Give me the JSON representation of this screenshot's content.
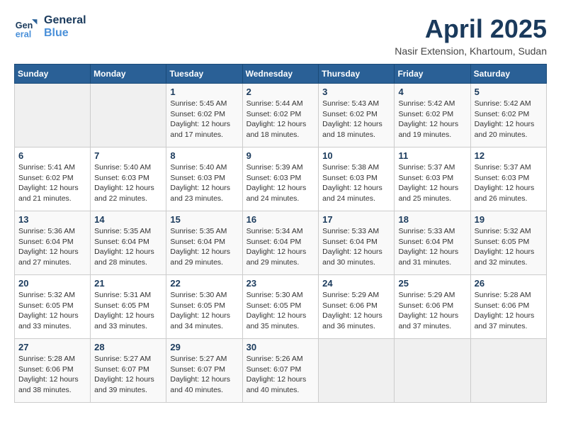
{
  "logo": {
    "line1": "General",
    "line2": "Blue"
  },
  "title": "April 2025",
  "subtitle": "Nasir Extension, Khartoum, Sudan",
  "weekdays": [
    "Sunday",
    "Monday",
    "Tuesday",
    "Wednesday",
    "Thursday",
    "Friday",
    "Saturday"
  ],
  "weeks": [
    [
      {
        "day": "",
        "info": ""
      },
      {
        "day": "",
        "info": ""
      },
      {
        "day": "1",
        "info": "Sunrise: 5:45 AM\nSunset: 6:02 PM\nDaylight: 12 hours and 17 minutes."
      },
      {
        "day": "2",
        "info": "Sunrise: 5:44 AM\nSunset: 6:02 PM\nDaylight: 12 hours and 18 minutes."
      },
      {
        "day": "3",
        "info": "Sunrise: 5:43 AM\nSunset: 6:02 PM\nDaylight: 12 hours and 18 minutes."
      },
      {
        "day": "4",
        "info": "Sunrise: 5:42 AM\nSunset: 6:02 PM\nDaylight: 12 hours and 19 minutes."
      },
      {
        "day": "5",
        "info": "Sunrise: 5:42 AM\nSunset: 6:02 PM\nDaylight: 12 hours and 20 minutes."
      }
    ],
    [
      {
        "day": "6",
        "info": "Sunrise: 5:41 AM\nSunset: 6:02 PM\nDaylight: 12 hours and 21 minutes."
      },
      {
        "day": "7",
        "info": "Sunrise: 5:40 AM\nSunset: 6:03 PM\nDaylight: 12 hours and 22 minutes."
      },
      {
        "day": "8",
        "info": "Sunrise: 5:40 AM\nSunset: 6:03 PM\nDaylight: 12 hours and 23 minutes."
      },
      {
        "day": "9",
        "info": "Sunrise: 5:39 AM\nSunset: 6:03 PM\nDaylight: 12 hours and 24 minutes."
      },
      {
        "day": "10",
        "info": "Sunrise: 5:38 AM\nSunset: 6:03 PM\nDaylight: 12 hours and 24 minutes."
      },
      {
        "day": "11",
        "info": "Sunrise: 5:37 AM\nSunset: 6:03 PM\nDaylight: 12 hours and 25 minutes."
      },
      {
        "day": "12",
        "info": "Sunrise: 5:37 AM\nSunset: 6:03 PM\nDaylight: 12 hours and 26 minutes."
      }
    ],
    [
      {
        "day": "13",
        "info": "Sunrise: 5:36 AM\nSunset: 6:04 PM\nDaylight: 12 hours and 27 minutes."
      },
      {
        "day": "14",
        "info": "Sunrise: 5:35 AM\nSunset: 6:04 PM\nDaylight: 12 hours and 28 minutes."
      },
      {
        "day": "15",
        "info": "Sunrise: 5:35 AM\nSunset: 6:04 PM\nDaylight: 12 hours and 29 minutes."
      },
      {
        "day": "16",
        "info": "Sunrise: 5:34 AM\nSunset: 6:04 PM\nDaylight: 12 hours and 29 minutes."
      },
      {
        "day": "17",
        "info": "Sunrise: 5:33 AM\nSunset: 6:04 PM\nDaylight: 12 hours and 30 minutes."
      },
      {
        "day": "18",
        "info": "Sunrise: 5:33 AM\nSunset: 6:04 PM\nDaylight: 12 hours and 31 minutes."
      },
      {
        "day": "19",
        "info": "Sunrise: 5:32 AM\nSunset: 6:05 PM\nDaylight: 12 hours and 32 minutes."
      }
    ],
    [
      {
        "day": "20",
        "info": "Sunrise: 5:32 AM\nSunset: 6:05 PM\nDaylight: 12 hours and 33 minutes."
      },
      {
        "day": "21",
        "info": "Sunrise: 5:31 AM\nSunset: 6:05 PM\nDaylight: 12 hours and 33 minutes."
      },
      {
        "day": "22",
        "info": "Sunrise: 5:30 AM\nSunset: 6:05 PM\nDaylight: 12 hours and 34 minutes."
      },
      {
        "day": "23",
        "info": "Sunrise: 5:30 AM\nSunset: 6:05 PM\nDaylight: 12 hours and 35 minutes."
      },
      {
        "day": "24",
        "info": "Sunrise: 5:29 AM\nSunset: 6:06 PM\nDaylight: 12 hours and 36 minutes."
      },
      {
        "day": "25",
        "info": "Sunrise: 5:29 AM\nSunset: 6:06 PM\nDaylight: 12 hours and 37 minutes."
      },
      {
        "day": "26",
        "info": "Sunrise: 5:28 AM\nSunset: 6:06 PM\nDaylight: 12 hours and 37 minutes."
      }
    ],
    [
      {
        "day": "27",
        "info": "Sunrise: 5:28 AM\nSunset: 6:06 PM\nDaylight: 12 hours and 38 minutes."
      },
      {
        "day": "28",
        "info": "Sunrise: 5:27 AM\nSunset: 6:07 PM\nDaylight: 12 hours and 39 minutes."
      },
      {
        "day": "29",
        "info": "Sunrise: 5:27 AM\nSunset: 6:07 PM\nDaylight: 12 hours and 40 minutes."
      },
      {
        "day": "30",
        "info": "Sunrise: 5:26 AM\nSunset: 6:07 PM\nDaylight: 12 hours and 40 minutes."
      },
      {
        "day": "",
        "info": ""
      },
      {
        "day": "",
        "info": ""
      },
      {
        "day": "",
        "info": ""
      }
    ]
  ]
}
